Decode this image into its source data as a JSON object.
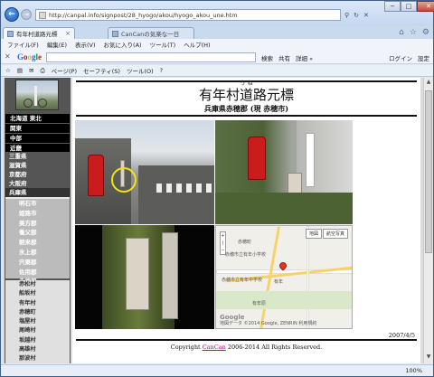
{
  "browser": {
    "url": "http://canpal.info/signpost/28_hyogo/akou/hyogo_akou_une.htm",
    "tabs": [
      {
        "label": "有年村道路元標",
        "active": true
      },
      {
        "label": "CanCanの気楽な一日",
        "active": false
      }
    ],
    "window_controls": {
      "minimize": "−",
      "maximize": "□",
      "close": "✕"
    },
    "address_tools": {
      "refresh": "↻",
      "search": "⚲",
      "stop": "✕"
    },
    "right_icons": {
      "home": "⌂",
      "favorites": "☆",
      "settings": "⚙"
    }
  },
  "menu": [
    "ファイル(F)",
    "編集(E)",
    "表示(V)",
    "お気に入り(A)",
    "ツール(T)",
    "ヘルプ(H)"
  ],
  "google_toolbar": {
    "logo": [
      "G",
      "o",
      "o",
      "g",
      "l",
      "e"
    ],
    "search_label": "検索",
    "share_label": "共有",
    "more_label": "詳細 »",
    "login_label": "ログイン",
    "settings_label": "設定"
  },
  "command_bar": {
    "page": "ページ(P)",
    "safety": "セーフティ(S)",
    "tools": "ツール(O)",
    "help": "?"
  },
  "leftnav": {
    "regions": [
      "北海道 東北",
      "関東",
      "中部",
      "近畿"
    ],
    "prefectures": [
      "三重県",
      "滋賀県",
      "京都府",
      "大阪府",
      "兵庫県"
    ],
    "areas": [
      "明石市",
      "姫路市",
      "美方郡",
      "養父郡",
      "朝来郡",
      "氷上郡",
      "宍粟郡",
      "佐用郡",
      "赤穂郡"
    ],
    "cities": [
      "赤松村",
      "船坂村",
      "有年村",
      "赤穂町",
      "塩屋村",
      "尾崎村",
      "坂越村",
      "高雄村",
      "那波村"
    ]
  },
  "content": {
    "title_ruby": "う ね",
    "title": "有年村道路元標",
    "subtitle": "兵庫県赤穂郡 (現 赤穂市)",
    "date": "2007/4/5",
    "copyright_prefix": "Copyright ",
    "copyright_link": "CanCan",
    "copyright_suffix": " 2006-2014 All Rights Reserved."
  },
  "map": {
    "buttons": [
      "地図",
      "航空写真"
    ],
    "labels": [
      "赤穂町",
      "有年",
      "赤穂市立有年中学校",
      "赤穂市立有年小学校",
      "有年原",
      "Google"
    ],
    "footer": "地図データ ©2014 Google, ZENRIN  利用規約"
  },
  "status": {
    "zoom": "100%"
  }
}
